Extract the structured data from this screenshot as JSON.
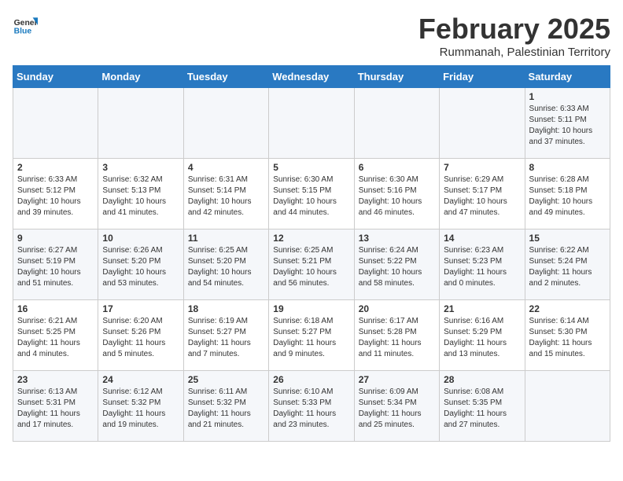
{
  "header": {
    "logo": {
      "general": "General",
      "blue": "Blue"
    },
    "title": "February 2025",
    "subtitle": "Rummanah, Palestinian Territory"
  },
  "days_of_week": [
    "Sunday",
    "Monday",
    "Tuesday",
    "Wednesday",
    "Thursday",
    "Friday",
    "Saturday"
  ],
  "weeks": [
    [
      {
        "day": "",
        "info": ""
      },
      {
        "day": "",
        "info": ""
      },
      {
        "day": "",
        "info": ""
      },
      {
        "day": "",
        "info": ""
      },
      {
        "day": "",
        "info": ""
      },
      {
        "day": "",
        "info": ""
      },
      {
        "day": "1",
        "info": "Sunrise: 6:33 AM\nSunset: 5:11 PM\nDaylight: 10 hours\nand 37 minutes."
      }
    ],
    [
      {
        "day": "2",
        "info": "Sunrise: 6:33 AM\nSunset: 5:12 PM\nDaylight: 10 hours\nand 39 minutes."
      },
      {
        "day": "3",
        "info": "Sunrise: 6:32 AM\nSunset: 5:13 PM\nDaylight: 10 hours\nand 41 minutes."
      },
      {
        "day": "4",
        "info": "Sunrise: 6:31 AM\nSunset: 5:14 PM\nDaylight: 10 hours\nand 42 minutes."
      },
      {
        "day": "5",
        "info": "Sunrise: 6:30 AM\nSunset: 5:15 PM\nDaylight: 10 hours\nand 44 minutes."
      },
      {
        "day": "6",
        "info": "Sunrise: 6:30 AM\nSunset: 5:16 PM\nDaylight: 10 hours\nand 46 minutes."
      },
      {
        "day": "7",
        "info": "Sunrise: 6:29 AM\nSunset: 5:17 PM\nDaylight: 10 hours\nand 47 minutes."
      },
      {
        "day": "8",
        "info": "Sunrise: 6:28 AM\nSunset: 5:18 PM\nDaylight: 10 hours\nand 49 minutes."
      }
    ],
    [
      {
        "day": "9",
        "info": "Sunrise: 6:27 AM\nSunset: 5:19 PM\nDaylight: 10 hours\nand 51 minutes."
      },
      {
        "day": "10",
        "info": "Sunrise: 6:26 AM\nSunset: 5:20 PM\nDaylight: 10 hours\nand 53 minutes."
      },
      {
        "day": "11",
        "info": "Sunrise: 6:25 AM\nSunset: 5:20 PM\nDaylight: 10 hours\nand 54 minutes."
      },
      {
        "day": "12",
        "info": "Sunrise: 6:25 AM\nSunset: 5:21 PM\nDaylight: 10 hours\nand 56 minutes."
      },
      {
        "day": "13",
        "info": "Sunrise: 6:24 AM\nSunset: 5:22 PM\nDaylight: 10 hours\nand 58 minutes."
      },
      {
        "day": "14",
        "info": "Sunrise: 6:23 AM\nSunset: 5:23 PM\nDaylight: 11 hours\nand 0 minutes."
      },
      {
        "day": "15",
        "info": "Sunrise: 6:22 AM\nSunset: 5:24 PM\nDaylight: 11 hours\nand 2 minutes."
      }
    ],
    [
      {
        "day": "16",
        "info": "Sunrise: 6:21 AM\nSunset: 5:25 PM\nDaylight: 11 hours\nand 4 minutes."
      },
      {
        "day": "17",
        "info": "Sunrise: 6:20 AM\nSunset: 5:26 PM\nDaylight: 11 hours\nand 5 minutes."
      },
      {
        "day": "18",
        "info": "Sunrise: 6:19 AM\nSunset: 5:27 PM\nDaylight: 11 hours\nand 7 minutes."
      },
      {
        "day": "19",
        "info": "Sunrise: 6:18 AM\nSunset: 5:27 PM\nDaylight: 11 hours\nand 9 minutes."
      },
      {
        "day": "20",
        "info": "Sunrise: 6:17 AM\nSunset: 5:28 PM\nDaylight: 11 hours\nand 11 minutes."
      },
      {
        "day": "21",
        "info": "Sunrise: 6:16 AM\nSunset: 5:29 PM\nDaylight: 11 hours\nand 13 minutes."
      },
      {
        "day": "22",
        "info": "Sunrise: 6:14 AM\nSunset: 5:30 PM\nDaylight: 11 hours\nand 15 minutes."
      }
    ],
    [
      {
        "day": "23",
        "info": "Sunrise: 6:13 AM\nSunset: 5:31 PM\nDaylight: 11 hours\nand 17 minutes."
      },
      {
        "day": "24",
        "info": "Sunrise: 6:12 AM\nSunset: 5:32 PM\nDaylight: 11 hours\nand 19 minutes."
      },
      {
        "day": "25",
        "info": "Sunrise: 6:11 AM\nSunset: 5:32 PM\nDaylight: 11 hours\nand 21 minutes."
      },
      {
        "day": "26",
        "info": "Sunrise: 6:10 AM\nSunset: 5:33 PM\nDaylight: 11 hours\nand 23 minutes."
      },
      {
        "day": "27",
        "info": "Sunrise: 6:09 AM\nSunset: 5:34 PM\nDaylight: 11 hours\nand 25 minutes."
      },
      {
        "day": "28",
        "info": "Sunrise: 6:08 AM\nSunset: 5:35 PM\nDaylight: 11 hours\nand 27 minutes."
      },
      {
        "day": "",
        "info": ""
      }
    ]
  ]
}
